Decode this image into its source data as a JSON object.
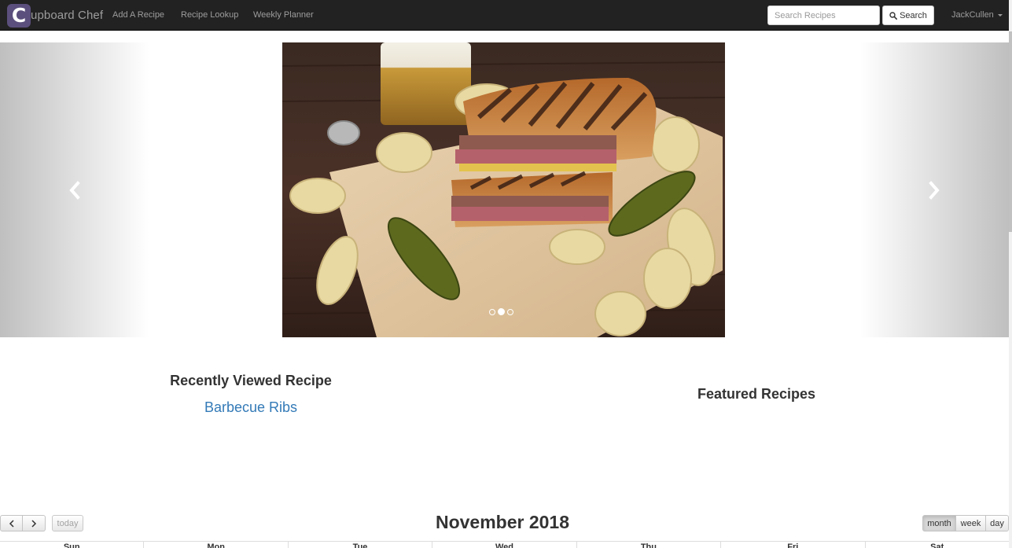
{
  "navbar": {
    "brand_logo": "C",
    "brand_text": "upboard Chef",
    "links": [
      "Add A Recipe",
      "Recipe Lookup",
      "Weekly Planner"
    ],
    "search_placeholder": "Search Recipes",
    "search_button": "Search",
    "user": "JackCullen"
  },
  "carousel": {
    "image_icon": "cuban-sandwich-photo",
    "slide_count": 3,
    "active_slide": 2,
    "prev_icon": "chevron-left-icon",
    "next_icon": "chevron-right-icon"
  },
  "recent": {
    "heading": "Recently Viewed Recipe",
    "link": "Barbecue Ribs"
  },
  "featured": {
    "heading": "Featured Recipes"
  },
  "calendar": {
    "prev_label": "<",
    "next_label": ">",
    "today_label": "today",
    "title": "November 2018",
    "views": [
      "month",
      "week",
      "day"
    ],
    "active_view": "month",
    "days": [
      "Sun",
      "Mon",
      "Tue",
      "Wed",
      "Thu",
      "Fri",
      "Sat"
    ]
  },
  "colors": {
    "navbar_bg": "#222222",
    "nav_text": "#9d9d9d",
    "link": "#337ab7",
    "brand_logo_bg": "#5b4f7d"
  }
}
